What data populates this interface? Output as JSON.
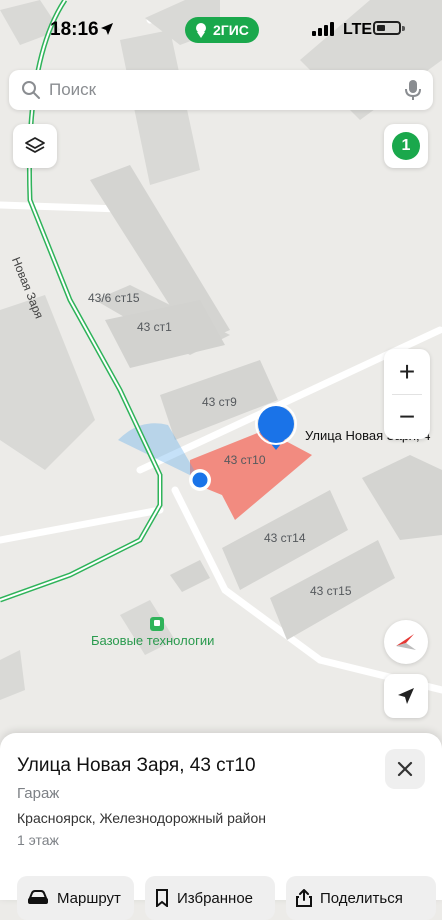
{
  "status_bar": {
    "time": "18:16",
    "network": "LTE"
  },
  "brand": {
    "name": "2ГИС"
  },
  "search": {
    "placeholder": "Поиск"
  },
  "map_controls": {
    "notifications_count": "1",
    "zoom_in": "+",
    "zoom_out": "−"
  },
  "map": {
    "street_label": "Новая Заря",
    "buildings": [
      "43/6 ст15",
      "43 ст1",
      "43 ст9",
      "43 ст10",
      "43 ст14",
      "43 ст15"
    ],
    "selected_label": "Улица Новая Заря, 4",
    "poi_name": "Базовые технологии"
  },
  "place": {
    "title": "Улица Новая Заря, 43 ст10",
    "type": "Гараж",
    "address": "Красноярск, Железнодорожный район",
    "floors": "1 этаж"
  },
  "actions": {
    "route": "Маршрут",
    "favorites": "Избранное",
    "share": "Поделиться"
  },
  "colors": {
    "accent": "#1aa84c",
    "selected_building": "#f28b80",
    "pin": "#1a73e8"
  }
}
